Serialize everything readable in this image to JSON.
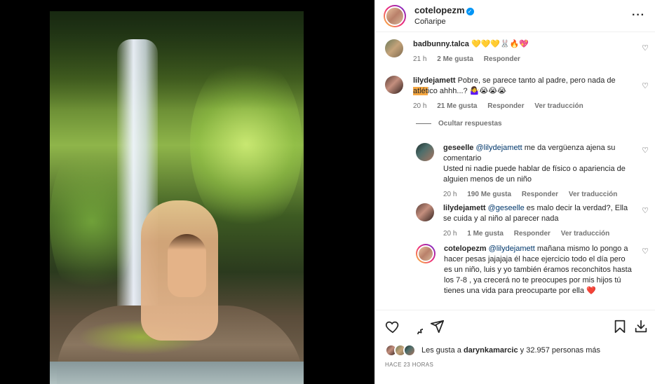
{
  "post": {
    "author": "cotelopezm",
    "location": "Coñaripe"
  },
  "comments": [
    {
      "user": "badbunny.talca",
      "text": "💛💛💛🐰🔥💖",
      "time": "21 h",
      "likes": "2 Me gusta",
      "reply": "Responder"
    },
    {
      "user": "lilydejamett",
      "text_before": "Pobre, se parece tanto al padre, pero nada de ",
      "text_highlight": "atlét",
      "text_after": "ico ahhh...? 🤷‍♀️😭😭😭",
      "time": "20 h",
      "likes": "21 Me gusta",
      "reply": "Responder",
      "translate": "Ver traducción"
    }
  ],
  "replies_toggle": "Ocultar respuestas",
  "replies": [
    {
      "user": "geseelle",
      "mention": "@lilydejamett",
      "text": " me da vergüenza ajena su comentario",
      "text2": "Usted ni nadie puede hablar de físico o apariencia de alguien menos de un niño",
      "time": "20 h",
      "likes": "190 Me gusta",
      "reply": "Responder",
      "translate": "Ver traducción"
    },
    {
      "user": "lilydejamett",
      "mention": "@geseelle",
      "text": " es malo decir la verdad?, Ella se cuida y al niño al parecer nada",
      "time": "20 h",
      "likes": "1 Me gusta",
      "reply": "Responder",
      "translate": "Ver traducción"
    },
    {
      "user": "cotelopezm",
      "mention": "@lilydejamett",
      "text": " mañana mismo lo pongo a hacer pesas jajajaja él hace ejercicio todo el día pero es un niño, luis y yo también éramos reconchitos hasta los 7-8 , ya crecerá no te preocupes por mis hijos tú tienes una vida para preocuparte por ella ❤️"
    }
  ],
  "likes_summary": {
    "prefix": "Les gusta a ",
    "user": "darynkamarcic",
    "suffix": " y 32.957 personas más"
  },
  "timestamp": "HACE 23 HORAS",
  "icons": [
    "heart-icon",
    "comment-icon",
    "share-icon",
    "bookmark-icon",
    "download-icon",
    "more-icon",
    "verified-icon"
  ],
  "colors": {
    "verified": "#0095f6",
    "mention": "#00376b",
    "highlight": "#f5a742",
    "like_red": "#ed4956"
  }
}
